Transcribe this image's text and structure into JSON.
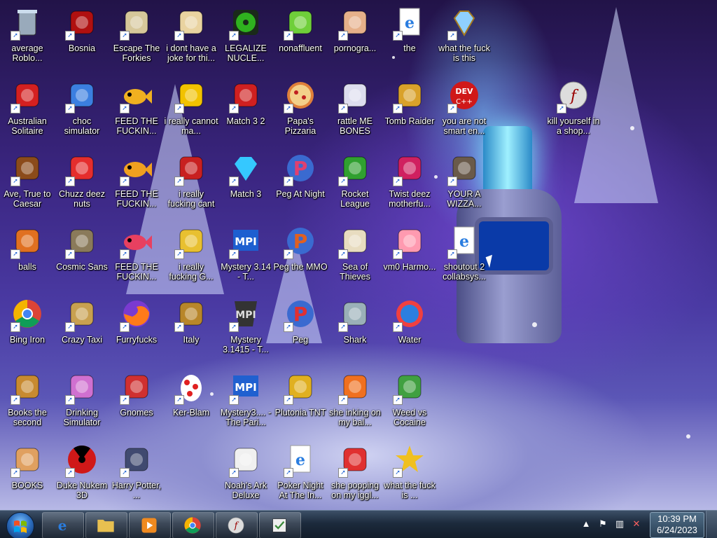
{
  "desktop": {
    "icons": [
      {
        "label": "average Roblo...",
        "icon": "recycle-bin-icon",
        "color": "#9ab"
      },
      {
        "label": "Bosnia",
        "icon": "bosnia-icon",
        "color": "#b01010"
      },
      {
        "label": "Escape The Forkies",
        "icon": "moon-icon",
        "color": "#d6c79a"
      },
      {
        "label": "i dont have a joke for thi...",
        "icon": "character-icon",
        "color": "#e9d3a0"
      },
      {
        "label": "LEGALIZE NUCLE...",
        "icon": "radiation-icon",
        "color": "#2fb21f"
      },
      {
        "label": "nonaffluent",
        "icon": "frog-icon",
        "color": "#6fcf3a"
      },
      {
        "label": "pornogra...",
        "icon": "anime-girl-icon",
        "color": "#e6b08a"
      },
      {
        "label": "the",
        "icon": "ie-document-icon",
        "color": "#2a7de0"
      },
      {
        "label": "what the fuck is this",
        "icon": "gem-icon",
        "color": "#8fd0ff"
      },
      {
        "label": "Australian Solitaire",
        "icon": "spider-icon",
        "color": "#d42020"
      },
      {
        "label": "choc simulator",
        "icon": "phone-icon",
        "color": "#3b7fe0"
      },
      {
        "label": "FEED THE FUCKIN...",
        "icon": "fish-icon",
        "color": "#f0b020"
      },
      {
        "label": "i really cannot ma...",
        "icon": "mahjong-icon",
        "color": "#f2c200"
      },
      {
        "label": "Match 3 2",
        "icon": "match-icon",
        "color": "#d02020"
      },
      {
        "label": "Papa's Pizzaria",
        "icon": "pizza-icon",
        "color": "#e0803a"
      },
      {
        "label": "rattle ME BONES",
        "icon": "yeti-icon",
        "color": "#dde"
      },
      {
        "label": "Tomb Raider",
        "icon": "compass-icon",
        "color": "#d9a12a"
      },
      {
        "label": "you are not smart en...",
        "icon": "dev-cpp-icon",
        "color": "#d01818"
      },
      {
        "label": "kill yourself in a shop...",
        "icon": "flash-icon",
        "color": "#888"
      },
      {
        "label": "Ave, True to Caesar",
        "icon": "runner-icon",
        "color": "#8b4b1a"
      },
      {
        "label": "Chuzz deez nuts",
        "icon": "chuzzle-icon",
        "color": "#e52d2d"
      },
      {
        "label": "FEED THE FUCKIN...",
        "icon": "fish-icon",
        "color": "#f0a020"
      },
      {
        "label": "i really fucking cant",
        "icon": "torii-icon",
        "color": "#c82020"
      },
      {
        "label": "Match 3",
        "icon": "diamond-icon",
        "color": "#35c8ff"
      },
      {
        "label": "Peg At Night",
        "icon": "peggle-icon",
        "color": "#e04070"
      },
      {
        "label": "Rocket League",
        "icon": "rocket-icon",
        "color": "#30a030"
      },
      {
        "label": "Twist deez motherfu...",
        "icon": "twist-icon",
        "color": "#d02060"
      },
      {
        "label": "YOUR A WIZZA...",
        "icon": "wizard-icon",
        "color": "#6a5a4a"
      },
      {
        "label": "balls",
        "icon": "blocks-icon",
        "color": "#e07020"
      },
      {
        "label": "Cosmic Sans",
        "icon": "gear-icon",
        "color": "#8a7a5a"
      },
      {
        "label": "FEED THE FUCKIN...",
        "icon": "fish-icon",
        "color": "#e84060"
      },
      {
        "label": "i really fucking G...",
        "icon": "ningpo-icon",
        "color": "#e8c030"
      },
      {
        "label": "Mystery 3.14 - T...",
        "icon": "mpi-icon",
        "color": "#1d5fd0"
      },
      {
        "label": "Peg the MMO",
        "icon": "peggle-icon",
        "color": "#e06020"
      },
      {
        "label": "Sea of Thieves",
        "icon": "skull-icon",
        "color": "#e8dcc0"
      },
      {
        "label": "vm0 Harmo...",
        "icon": "flower-icon",
        "color": "#ff9ab0"
      },
      {
        "label": "shoutout 2 collabsys...",
        "icon": "ie-document-icon",
        "color": "#2a7de0"
      },
      {
        "label": "Bing Iron",
        "icon": "chrome-icon",
        "color": "#4285f4"
      },
      {
        "label": "Crazy Taxi",
        "icon": "money-bag-icon",
        "color": "#c8a050"
      },
      {
        "label": "Furryfucks",
        "icon": "firefox-icon",
        "color": "#ff7a1a"
      },
      {
        "label": "Italy",
        "icon": "ship-icon",
        "color": "#b8862a"
      },
      {
        "label": "Mystery 3.1415 - T...",
        "icon": "mpi-dark-icon",
        "color": "#333"
      },
      {
        "label": "Peg",
        "icon": "peggle-icon",
        "color": "#e03030"
      },
      {
        "label": "Shark",
        "icon": "shark-icon",
        "color": "#9ab0b8"
      },
      {
        "label": "Water",
        "icon": "water-icon",
        "color": "#2b7fe0"
      },
      {
        "label": "Books the second",
        "icon": "book-icon",
        "color": "#c88a30"
      },
      {
        "label": "Drinking Simulator",
        "icon": "martini-icon",
        "color": "#d070d0"
      },
      {
        "label": "Gnomes",
        "icon": "gnome-icon",
        "color": "#d03030"
      },
      {
        "label": "Ker-Blam",
        "icon": "egg-icon",
        "color": "#e02020"
      },
      {
        "label": "Mystery3.... - The Pari...",
        "icon": "mpi-icon",
        "color": "#2060d0"
      },
      {
        "label": "Plutonia TNT",
        "icon": "doom-icon",
        "color": "#e0b020"
      },
      {
        "label": "she inking on my bal...",
        "icon": "paint-icon",
        "color": "#f07020"
      },
      {
        "label": "Weed vs Cocaine",
        "icon": "plant-icon",
        "color": "#40a040"
      },
      {
        "label": "BOOKS",
        "icon": "bookworm-icon",
        "color": "#e0a060"
      },
      {
        "label": "Duke Nukem 3D",
        "icon": "nuke-icon",
        "color": "#d01818"
      },
      {
        "label": "Harry Potter, ...",
        "icon": "tower-icon",
        "color": "#404a70"
      },
      {
        "label": "Noah's Ark Deluxe",
        "icon": "dove-icon",
        "color": "#f0f0f0"
      },
      {
        "label": "Poker Night At The In...",
        "icon": "ie-document-icon",
        "color": "#2a7de0"
      },
      {
        "label": "she popping on my iggl...",
        "icon": "bird-icon",
        "color": "#e03030"
      },
      {
        "label": "what the fuck is ...",
        "icon": "star-icon",
        "color": "#f0c020"
      }
    ]
  },
  "taskbar": {
    "start_icon": "windows-orb-icon",
    "pinned": [
      {
        "name": "internet-explorer",
        "icon": "ie-icon",
        "color": "#2a7de0"
      },
      {
        "name": "file-explorer",
        "icon": "folder-icon",
        "color": "#e8c050"
      },
      {
        "name": "media-player",
        "icon": "media-player-icon",
        "color": "#f08a20"
      },
      {
        "name": "chrome",
        "icon": "chrome-icon",
        "color": "#4285f4"
      },
      {
        "name": "flash",
        "icon": "flash-icon",
        "color": "#999"
      },
      {
        "name": "app",
        "icon": "check-app-icon",
        "color": "#3a8a3a"
      }
    ],
    "tray": {
      "icons": [
        "chevron-up-icon",
        "flag-icon",
        "network-icon",
        "volume-muted-icon"
      ],
      "time": "10:39 PM",
      "date": "6/24/2023"
    }
  }
}
